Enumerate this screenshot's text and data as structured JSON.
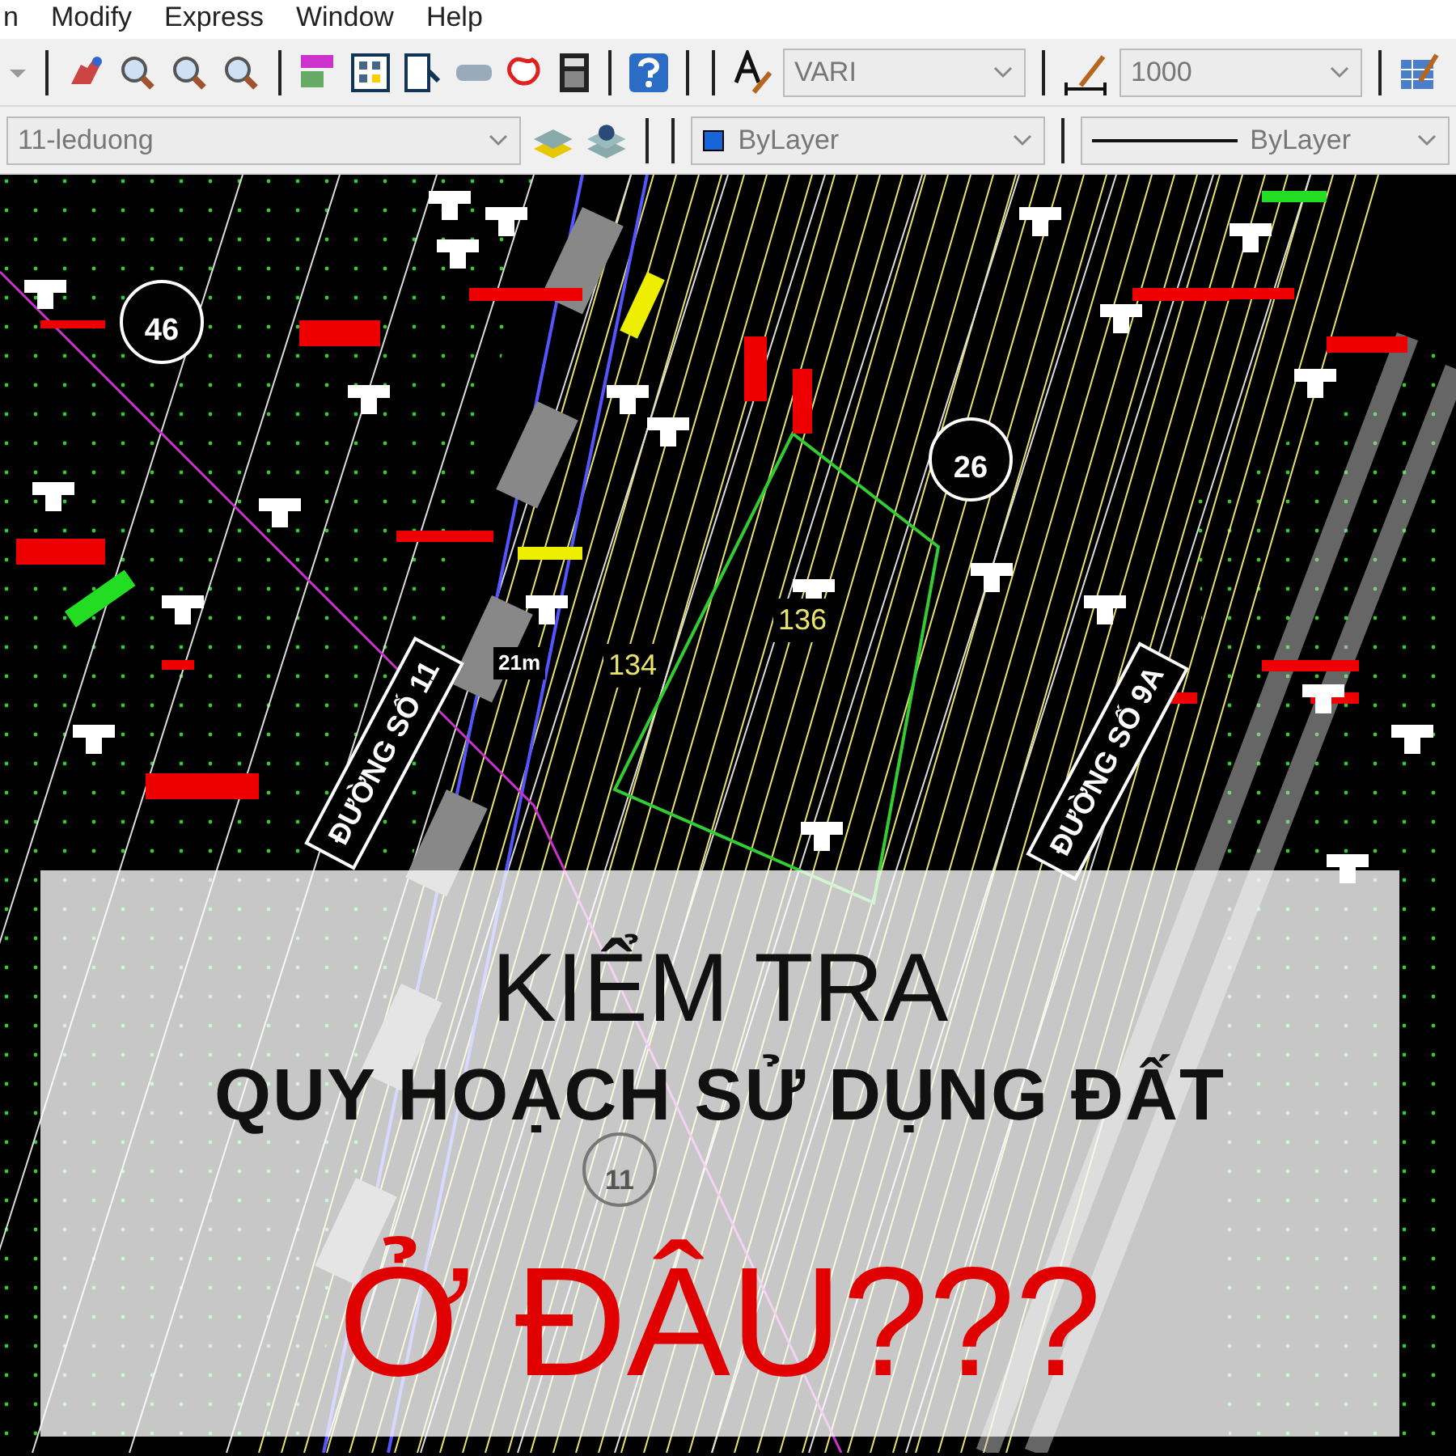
{
  "menu_bar": {
    "items": [
      "n",
      "Modify",
      "Express",
      "Window",
      "Help"
    ]
  },
  "toolbar": {
    "text_style": "VARI",
    "dimension_scale": "1000"
  },
  "layers_toolbar": {
    "layer": "11-leduong",
    "color_name": "ByLayer",
    "color": "#1565d8",
    "linetype": "ByLayer"
  },
  "drawing": {
    "labels": [
      {
        "kind": "bubble",
        "text": "46"
      },
      {
        "kind": "bubble",
        "text": "26"
      },
      {
        "kind": "bubble",
        "text": "11"
      },
      {
        "kind": "plot",
        "text": "136"
      },
      {
        "kind": "plot",
        "text": "134"
      },
      {
        "kind": "dimension",
        "text": "21m"
      },
      {
        "kind": "road",
        "text": "ĐƯỜNG SỐ 11"
      },
      {
        "kind": "road",
        "text": "ĐƯỜNG SỐ 9A"
      }
    ]
  },
  "overlay": {
    "line_1": "KIỂM TRA",
    "line_2": "QUY HOẠCH SỬ DỤNG ĐẤT",
    "line_3": "Ở ĐÂU???"
  }
}
